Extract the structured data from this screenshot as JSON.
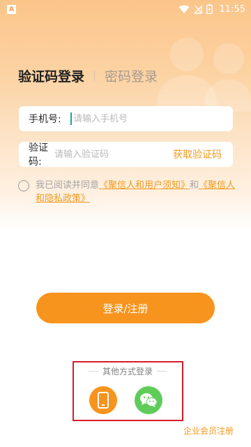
{
  "status_bar": {
    "app_icon_letter": "A",
    "time": "11:55"
  },
  "tabs": {
    "active": "验证码登录",
    "inactive": "密码登录"
  },
  "phone_field": {
    "label": "手机号:",
    "placeholder": "请输入手机号",
    "value": ""
  },
  "code_field": {
    "label": "验证码:",
    "placeholder": "请输入验证码",
    "value": "",
    "action": "获取验证码"
  },
  "agreement": {
    "prefix": "我已阅读并同意",
    "link1": "《聚信人和用户须知》",
    "conjunction": "和",
    "link2": "《聚信人和隐私政策》"
  },
  "login_button": "登录/注册",
  "other_login": {
    "title": "其他方式登录",
    "options": [
      "phone-icon",
      "wechat-icon"
    ]
  },
  "enterprise_link": "企业会员注册",
  "colors": {
    "accent": "#f7941d",
    "link": "#f39a1d",
    "wechat": "#5fcc5a",
    "highlight": "#d81b2a"
  }
}
